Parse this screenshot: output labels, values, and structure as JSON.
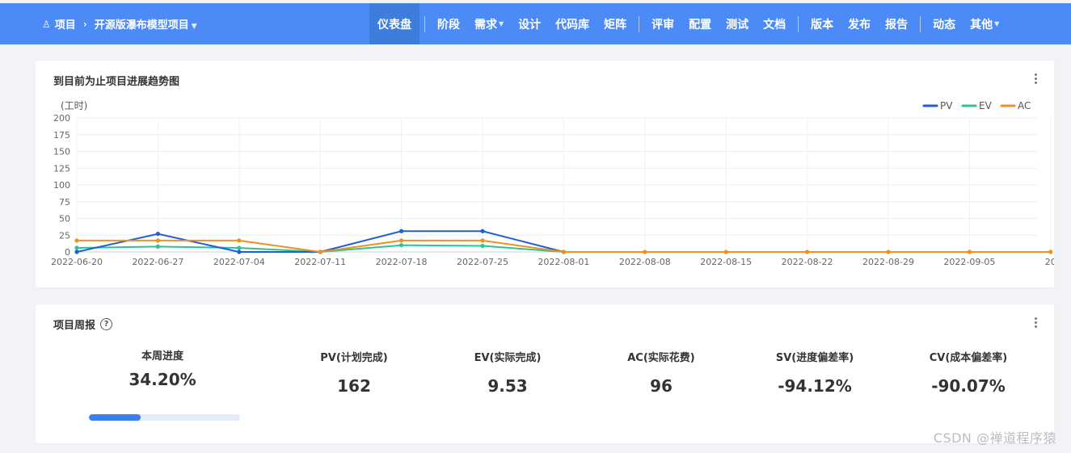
{
  "header": {
    "project_icon": "project-icon",
    "crumb_root": "项目",
    "crumb_project": "开源版瀑布模型项目",
    "nav": [
      {
        "label": "仪表盘",
        "active": true
      },
      {
        "label": "阶段"
      },
      {
        "label": "需求",
        "dropdown": true
      },
      {
        "label": "设计"
      },
      {
        "label": "代码库"
      },
      {
        "label": "矩阵"
      },
      {
        "label": "评审"
      },
      {
        "label": "配置"
      },
      {
        "label": "测试"
      },
      {
        "label": "文档"
      },
      {
        "label": "版本"
      },
      {
        "label": "发布"
      },
      {
        "label": "报告"
      },
      {
        "label": "动态"
      },
      {
        "label": "其他",
        "dropdown": true
      }
    ]
  },
  "trend_card": {
    "title": "到目前为止项目进展趋势图"
  },
  "chart_data": {
    "type": "line",
    "ylabel": "(工时)",
    "ylim": [
      0,
      200
    ],
    "yticks": [
      0,
      25,
      50,
      75,
      100,
      125,
      150,
      175,
      200
    ],
    "categories": [
      "2022-06-20",
      "2022-06-27",
      "2022-07-04",
      "2022-07-11",
      "2022-07-18",
      "2022-07-25",
      "2022-08-01",
      "2022-08-08",
      "2022-08-15",
      "2022-08-22",
      "2022-08-29",
      "2022-09-05",
      "20"
    ],
    "legend_position": "top-right",
    "grid": true,
    "series": [
      {
        "name": "PV",
        "color": "#1f5fd6",
        "values": [
          0,
          27,
          0,
          0,
          31,
          31,
          0,
          null,
          null,
          null,
          null,
          null,
          null
        ]
      },
      {
        "name": "EV",
        "color": "#2bc39a",
        "values": [
          6,
          8,
          6,
          0,
          10,
          9,
          0,
          null,
          null,
          null,
          null,
          null,
          null
        ]
      },
      {
        "name": "AC",
        "color": "#f0901e",
        "values": [
          17,
          17,
          17,
          0,
          17,
          17,
          0,
          0,
          0,
          0,
          0,
          0,
          0
        ]
      }
    ]
  },
  "weekly_card": {
    "title": "项目周报",
    "help_icon": "question-circle-icon",
    "progress_label": "本周进度",
    "progress_value": "34.20%",
    "progress_fraction": 0.342,
    "stats": [
      {
        "label": "PV(计划完成)",
        "value": "162"
      },
      {
        "label": "EV(实际完成)",
        "value": "9.53"
      },
      {
        "label": "AC(实际花费)",
        "value": "96"
      },
      {
        "label": "SV(进度偏差率)",
        "value": "-94.12%"
      },
      {
        "label": "CV(成本偏差率)",
        "value": "-90.07%"
      }
    ]
  },
  "watermark": "CSDN @禅道程序猿"
}
